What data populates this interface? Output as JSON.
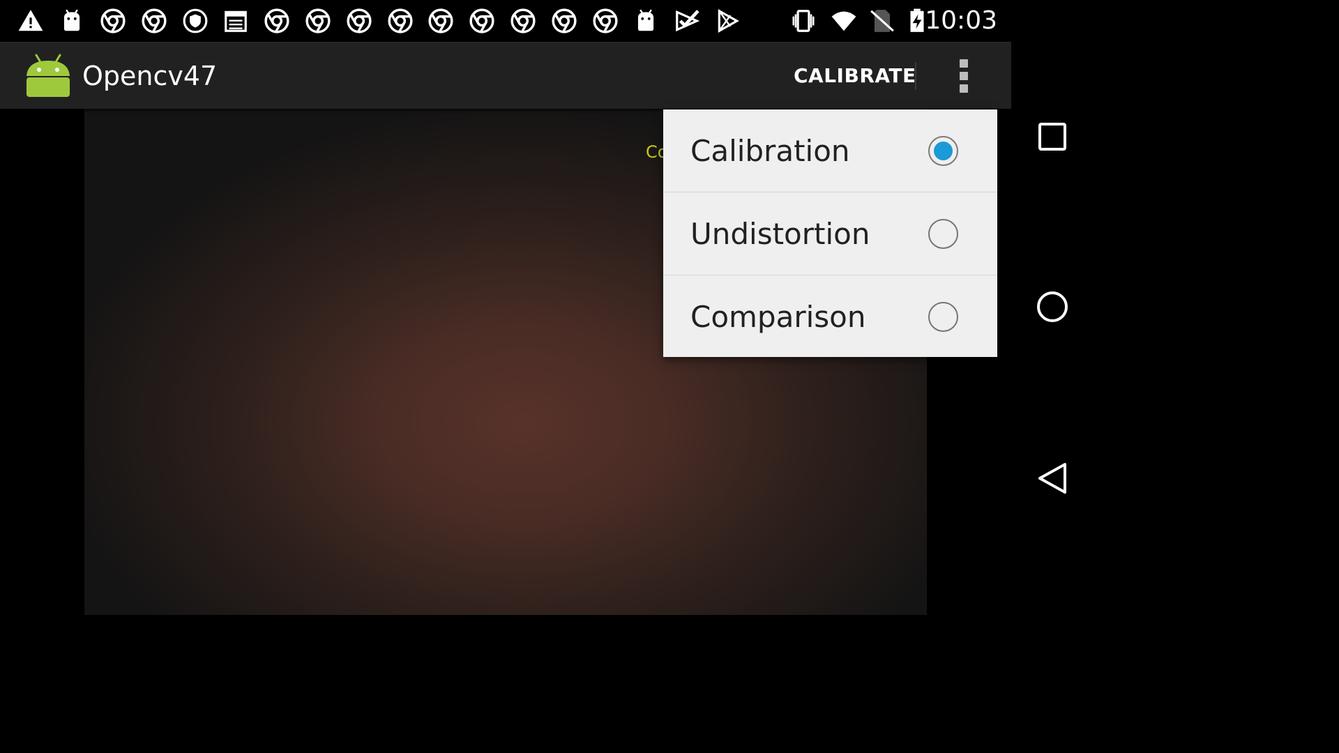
{
  "status_bar": {
    "time": "10:03",
    "notification_icons": [
      "warning-icon",
      "android-icon",
      "chrome-icon",
      "chrome-icon",
      "shield-icon",
      "calendar-icon",
      "chrome-icon",
      "chrome-icon",
      "chrome-icon",
      "chrome-icon",
      "chrome-icon",
      "chrome-icon",
      "chrome-icon",
      "chrome-icon",
      "chrome-icon",
      "android-icon",
      "check-play-icon",
      "play-store-icon"
    ],
    "system_icons": [
      "vibrate-icon",
      "wifi-icon",
      "no-sim-icon",
      "battery-charging-icon"
    ]
  },
  "action_bar": {
    "title": "Opencv47",
    "calibrate_label": "CALIBRATE",
    "background": "#212121"
  },
  "camera": {
    "overlay_text": "Co"
  },
  "menu": {
    "items": [
      {
        "label": "Calibration",
        "checked": true
      },
      {
        "label": "Undistortion",
        "checked": false
      },
      {
        "label": "Comparison",
        "checked": false
      }
    ],
    "accent_color": "#1a9ad6"
  },
  "nav_bar": {
    "buttons": [
      "recents-icon",
      "home-icon",
      "back-icon"
    ]
  }
}
